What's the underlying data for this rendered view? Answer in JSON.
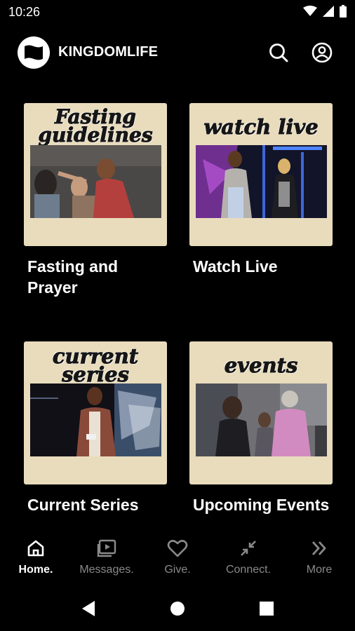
{
  "status_bar": {
    "time": "10:26"
  },
  "header": {
    "app_title": "KINGDOMLIFE"
  },
  "cards": [
    {
      "thumb_text": "Fasting guidelines",
      "title": "Fasting and Prayer"
    },
    {
      "thumb_text": "watch live",
      "title": "Watch Live"
    },
    {
      "thumb_text": "current series",
      "title": "Current Series"
    },
    {
      "thumb_text": "events",
      "title": "Upcoming Events"
    }
  ],
  "bottom_nav": [
    {
      "label": "Home.",
      "icon": "home-icon",
      "active": true
    },
    {
      "label": "Messages.",
      "icon": "video-library-icon",
      "active": false
    },
    {
      "label": "Give.",
      "icon": "heart-icon",
      "active": false
    },
    {
      "label": "Connect.",
      "icon": "connect-arrows-icon",
      "active": false
    },
    {
      "label": "More",
      "icon": "double-chevron-icon",
      "active": false
    }
  ],
  "colors": {
    "background": "#000000",
    "card_bg": "#e9dcbc",
    "inactive_nav": "#8a8a8a"
  }
}
